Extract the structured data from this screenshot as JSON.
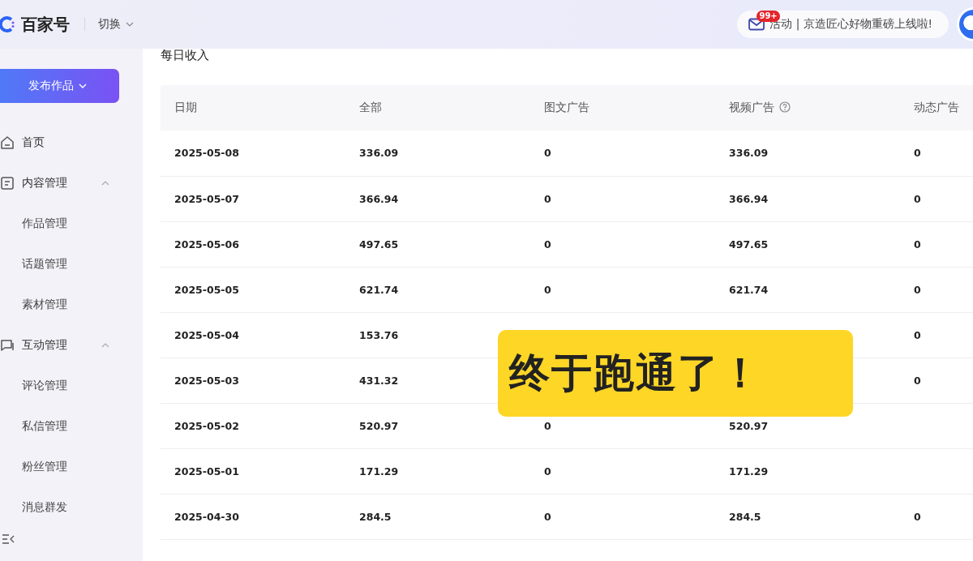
{
  "header": {
    "brand": "百家号",
    "switch_label": "切换",
    "notice": {
      "badge": "99+",
      "text": "活动 | 京造匠心好物重磅上线啦!"
    }
  },
  "sidebar": {
    "publish_button": "发布作品",
    "items": [
      {
        "label": "首页"
      },
      {
        "label": "内容管理",
        "expanded": true,
        "children": [
          {
            "label": "作品管理"
          },
          {
            "label": "话题管理"
          },
          {
            "label": "素材管理"
          }
        ]
      },
      {
        "label": "互动管理",
        "expanded": true,
        "children": [
          {
            "label": "评论管理"
          },
          {
            "label": "私信管理"
          },
          {
            "label": "粉丝管理"
          },
          {
            "label": "消息群发"
          }
        ]
      }
    ]
  },
  "section_title": "每日收入",
  "table": {
    "columns": [
      {
        "label": "日期"
      },
      {
        "label": "全部"
      },
      {
        "label": "图文广告"
      },
      {
        "label": "视频广告",
        "help": true
      },
      {
        "label": "动态广告"
      }
    ],
    "rows": [
      {
        "cells": [
          "2025-05-08",
          "336.09",
          "0",
          "336.09",
          "0"
        ]
      },
      {
        "cells": [
          "2025-05-07",
          "366.94",
          "0",
          "366.94",
          "0"
        ]
      },
      {
        "cells": [
          "2025-05-06",
          "497.65",
          "0",
          "497.65",
          "0"
        ]
      },
      {
        "cells": [
          "2025-05-05",
          "621.74",
          "0",
          "621.74",
          "0"
        ]
      },
      {
        "cells": [
          "2025-05-04",
          "153.76",
          null,
          null,
          "0"
        ]
      },
      {
        "cells": [
          "2025-05-03",
          "431.32",
          null,
          null,
          "0"
        ]
      },
      {
        "cells": [
          "2025-05-02",
          "520.97",
          "0",
          "520.97",
          null
        ]
      },
      {
        "cells": [
          "2025-05-01",
          "171.29",
          "0",
          "171.29",
          null
        ]
      },
      {
        "cells": [
          "2025-04-30",
          "284.5",
          "0",
          "284.5",
          "0"
        ]
      }
    ]
  },
  "sticker": "终于跑通了！"
}
